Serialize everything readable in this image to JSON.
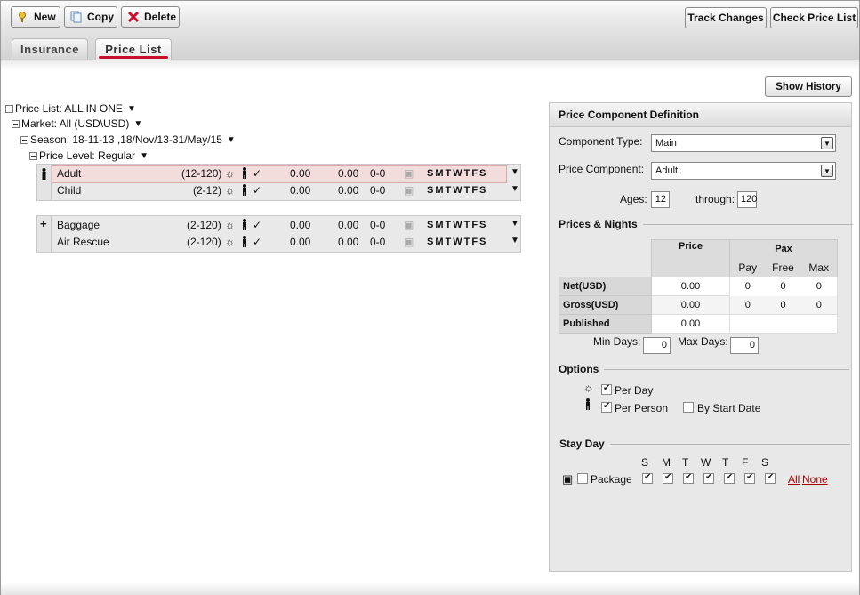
{
  "toolbar": {
    "new_label": "New",
    "copy_label": "Copy",
    "delete_label": "Delete",
    "track_changes_label": "Track Changes",
    "check_price_list_label": "Check Price List"
  },
  "tabs": [
    {
      "label": "Insurance",
      "active": false
    },
    {
      "label": "Price List",
      "active": true
    }
  ],
  "show_history_label": "Show History",
  "tree": {
    "price_list": "Price List: ALL IN ONE",
    "market": "Market: All (USD\\USD)",
    "season": "Season: 18-11-13 ,18/Nov/13-31/May/15",
    "price_level": "Price Level: Regular"
  },
  "group1": {
    "rows": [
      {
        "name": "Adult",
        "range": "(12-120)",
        "v1": "0.00",
        "v2": "0.00",
        "v3": "0-0",
        "days": "SMTWTFS",
        "selected": true
      },
      {
        "name": "Child",
        "range": "(2-12)",
        "v1": "0.00",
        "v2": "0.00",
        "v3": "0-0",
        "days": "SMTWTFS",
        "selected": false
      }
    ]
  },
  "group2": {
    "expander": "+",
    "rows": [
      {
        "name": "Baggage",
        "range": "(2-120)",
        "v1": "0.00",
        "v2": "0.00",
        "v3": "0-0",
        "days": "SMTWTFS"
      },
      {
        "name": "Air Rescue",
        "range": "(2-120)",
        "v1": "0.00",
        "v2": "0.00",
        "v3": "0-0",
        "days": "SMTWTFS"
      }
    ]
  },
  "panel": {
    "title": "Price Component Definition",
    "component_type_label": "Component Type:",
    "component_type_value": "Main",
    "price_component_label": "Price Component:",
    "price_component_value": "Adult",
    "ages_label": "Ages:",
    "ages_from": "12",
    "through_label": "through:",
    "ages_to": "120",
    "prices_nights_title": "Prices & Nights",
    "table": {
      "price_header": "Price",
      "pax_header": "Pax",
      "pay": "Pay",
      "free": "Free",
      "max": "Max",
      "rows": [
        {
          "label": "Net(USD)",
          "price": "0.00",
          "pay": "0",
          "free": "0",
          "max": "0"
        },
        {
          "label": "Gross(USD)",
          "price": "0.00",
          "pay": "0",
          "free": "0",
          "max": "0"
        },
        {
          "label": "Published",
          "price": "0.00"
        }
      ]
    },
    "min_days_label": "Min Days:",
    "min_days_value": "0",
    "max_days_label": "Max Days:",
    "max_days_value": "0",
    "options_title": "Options",
    "per_day_label": "Per Day",
    "per_person_label": "Per Person",
    "by_start_date_label": "By Start Date",
    "stay_day_title": "Stay Day",
    "day_letters": [
      "S",
      "M",
      "T",
      "W",
      "T",
      "F",
      "S"
    ],
    "package_label": "Package",
    "all_label": "All",
    "none_label": "None"
  }
}
